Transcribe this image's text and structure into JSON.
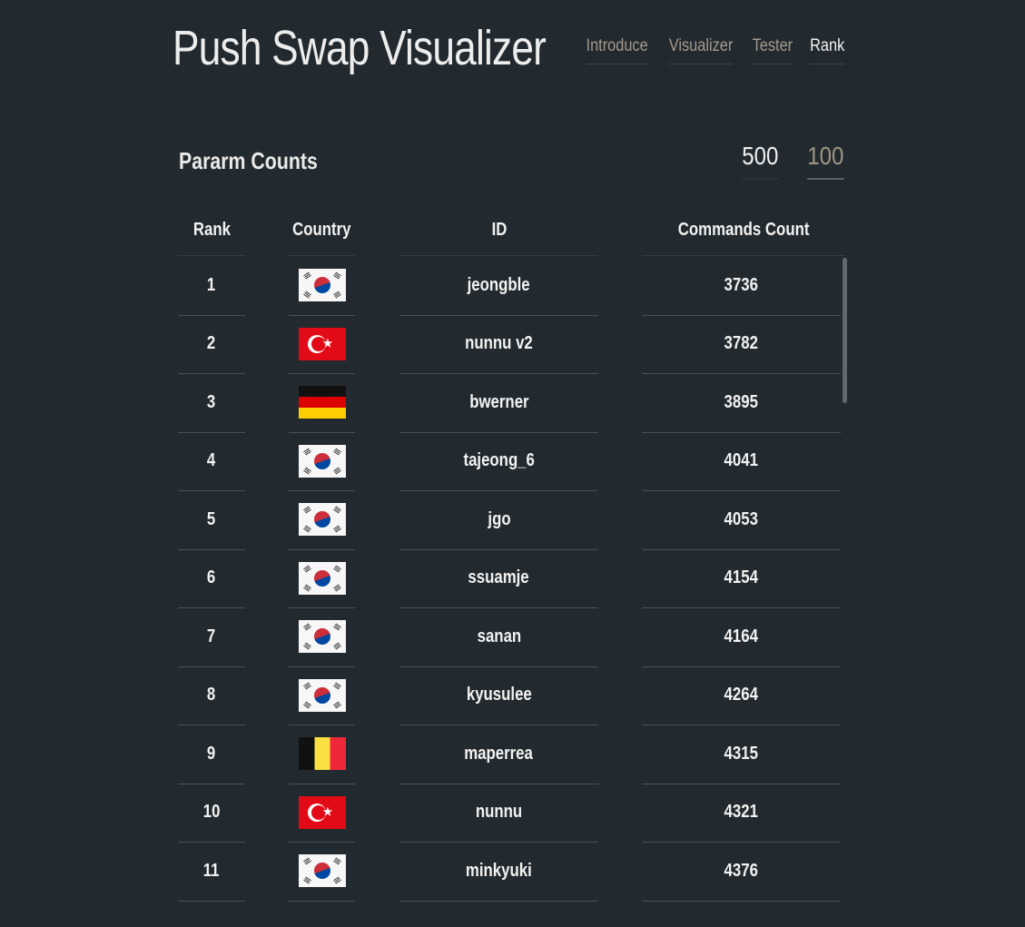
{
  "app": {
    "title": "Push Swap Visualizer"
  },
  "nav": [
    {
      "label": "Introduce",
      "active": false
    },
    {
      "label": "Visualizer",
      "active": false
    },
    {
      "label": "Tester",
      "active": false
    },
    {
      "label": "Rank",
      "active": true
    }
  ],
  "section": {
    "title": "Pararm Counts"
  },
  "param_toggle": {
    "options": [
      "500",
      "100"
    ],
    "selected": "500"
  },
  "table": {
    "headers": {
      "rank": "Rank",
      "country": "Country",
      "id": "ID",
      "commands": "Commands Count"
    },
    "rows": [
      {
        "rank": "1",
        "flag": "south-korea-flag",
        "id": "jeongble",
        "commands": "3736"
      },
      {
        "rank": "2",
        "flag": "turkey-flag",
        "id": "nunnu v2",
        "commands": "3782"
      },
      {
        "rank": "3",
        "flag": "germany-flag",
        "id": "bwerner",
        "commands": "3895"
      },
      {
        "rank": "4",
        "flag": "south-korea-flag",
        "id": "tajeong_6",
        "commands": "4041"
      },
      {
        "rank": "5",
        "flag": "south-korea-flag",
        "id": "jgo",
        "commands": "4053"
      },
      {
        "rank": "6",
        "flag": "south-korea-flag",
        "id": "ssuamje",
        "commands": "4154"
      },
      {
        "rank": "7",
        "flag": "south-korea-flag",
        "id": "sanan",
        "commands": "4164"
      },
      {
        "rank": "8",
        "flag": "south-korea-flag",
        "id": "kyusulee",
        "commands": "4264"
      },
      {
        "rank": "9",
        "flag": "belgium-flag",
        "id": "maperrea",
        "commands": "4315"
      },
      {
        "rank": "10",
        "flag": "turkey-flag",
        "id": "nunnu",
        "commands": "4321"
      },
      {
        "rank": "11",
        "flag": "south-korea-flag",
        "id": "minkyuki",
        "commands": "4376"
      }
    ]
  },
  "colors": {
    "background": "#232a2f",
    "text": "#f2f2f2",
    "muted": "#a39a8c",
    "divider": "#4a5156"
  }
}
